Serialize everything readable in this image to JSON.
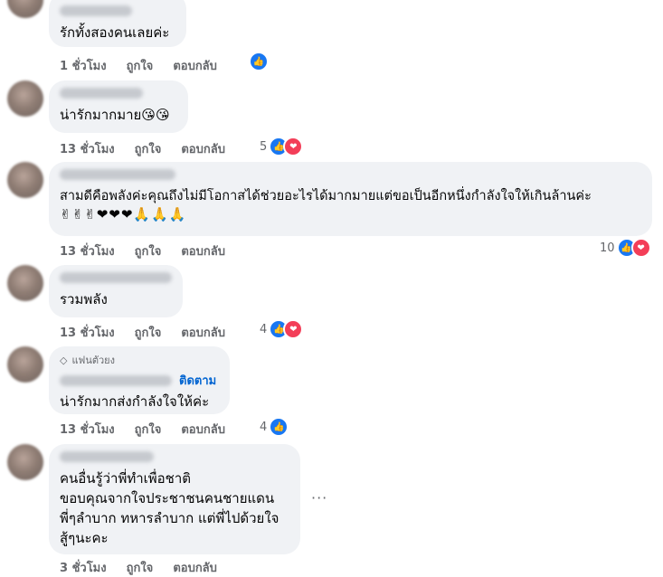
{
  "colors": {
    "like": "#1877f2",
    "love": "#f33e58",
    "bubble": "#f0f2f5",
    "meta": "#65676b",
    "link": "#0064d1"
  },
  "comments": [
    {
      "text": "รักทั้งสองคนเลยค่ะ",
      "time": "1 ชั่วโมง",
      "like": "ถูกใจ",
      "reply": "ตอบกลับ",
      "count": "",
      "reactions": [
        "like-icon"
      ]
    },
    {
      "text": "น่ารักมากมาย😘😘",
      "time": "13 ชั่วโมง",
      "like": "ถูกใจ",
      "reply": "ตอบกลับ",
      "count": "5",
      "reactions": [
        "like-icon",
        "love-icon"
      ]
    },
    {
      "text": "สามดีคือพลังค่ะคุณถึงไม่มีโอกาสได้ช่วยอะไรได้มากมายแต่ขอเป็นอีกหนึ่งกำลังใจให้เกินล้านค่ะ",
      "emojis": "✌✌✌❤❤❤🙏🙏🙏",
      "time": "13 ชั่วโมง",
      "like": "ถูกใจ",
      "reply": "ตอบกลับ",
      "count": "10",
      "reactions": [
        "like-icon",
        "love-icon"
      ]
    },
    {
      "text": "รวมพลัง",
      "time": "13 ชั่วโมง",
      "like": "ถูกใจ",
      "reply": "ตอบกลับ",
      "count": "4",
      "reactions": [
        "like-icon",
        "love-icon"
      ]
    },
    {
      "badge": "แฟนตัวยง",
      "follow": "ติดตาม",
      "text": "น่ารักมากส่งกำลังใจให้ค่ะ",
      "time": "13 ชั่วโมง",
      "like": "ถูกใจ",
      "reply": "ตอบกลับ",
      "count": "4",
      "reactions": [
        "like-icon"
      ]
    },
    {
      "lines": [
        "คนอื่นรู้ว่าพี่ทำเพื่อชาติ",
        "ขอบคุณจากใจประชาชนคนชายแดน",
        "พี่ๆลำบาก ทหารลำบาก แต่พี่ไปด้วยใจ",
        "สู้ๆนะคะ"
      ],
      "time": "3 ชั่วโมง",
      "like": "ถูกใจ",
      "reply": "ตอบกลับ",
      "more": "···"
    }
  ]
}
